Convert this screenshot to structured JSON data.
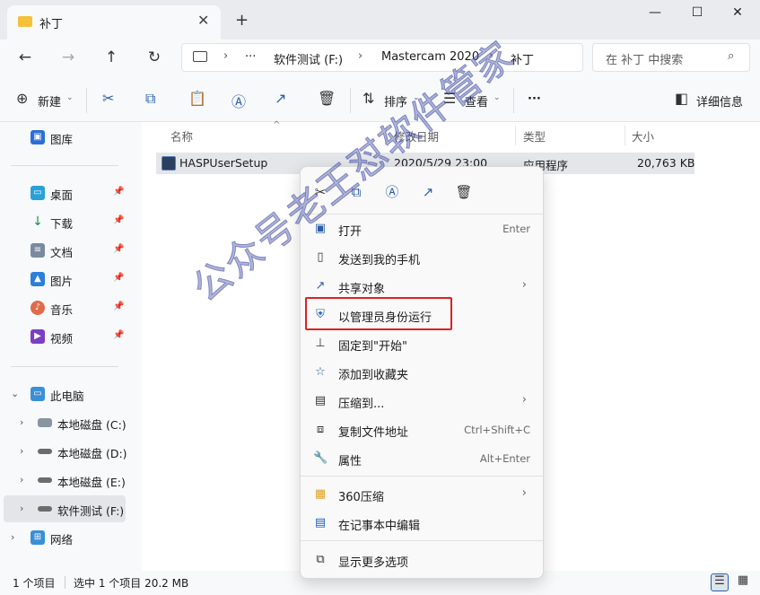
{
  "window": {
    "tab_title": "补丁",
    "tab_close": "✕",
    "new_tab": "+",
    "minimize": "—",
    "maximize": "☐",
    "close": "✕"
  },
  "nav": {
    "back": "←",
    "forward": "→",
    "up": "↑",
    "refresh": "↻",
    "more_crumbs": "···",
    "breadcrumbs": [
      "软件测试 (F:)",
      "Mastercam 2020",
      "补丁"
    ],
    "separator": "›",
    "search_placeholder": "在 补丁 中搜索",
    "search_icon": "⌕"
  },
  "commands": {
    "new_label": "新建",
    "sort_label": "排序",
    "view_label": "查看",
    "more": "···",
    "details_label": "详细信息",
    "caret": "⌄"
  },
  "sidebar": {
    "items": [
      {
        "label": "图库",
        "icon": "gallery-icon"
      },
      {
        "label": "桌面",
        "icon": "desktop-icon",
        "pinned": true
      },
      {
        "label": "下载",
        "icon": "download-icon",
        "pinned": true
      },
      {
        "label": "文档",
        "icon": "documents-icon",
        "pinned": true
      },
      {
        "label": "图片",
        "icon": "pictures-icon",
        "pinned": true
      },
      {
        "label": "音乐",
        "icon": "music-icon",
        "pinned": true
      },
      {
        "label": "视频",
        "icon": "videos-icon",
        "pinned": true
      },
      {
        "label": "此电脑",
        "icon": "this-pc-icon"
      },
      {
        "label": "本地磁盘 (C:)",
        "icon": "drive-icon"
      },
      {
        "label": "本地磁盘 (D:)",
        "icon": "drive-icon"
      },
      {
        "label": "本地磁盘 (E:)",
        "icon": "drive-icon"
      },
      {
        "label": "软件测试 (F:)",
        "icon": "drive-icon",
        "selected": true
      },
      {
        "label": "网络",
        "icon": "network-icon"
      }
    ],
    "pin_glyph": "📌",
    "expand_glyph": "›",
    "expanded_glyph": "⌄"
  },
  "columns": {
    "name": "名称",
    "date": "修改日期",
    "type": "类型",
    "size": "大小",
    "sort_caret": "^"
  },
  "files": [
    {
      "name": "HASPUserSetup",
      "date": "2020/5/29 23:00",
      "type": "应用程序",
      "size": "20,763 KB"
    }
  ],
  "context_menu": {
    "items": [
      {
        "label": "打开",
        "key": "Enter",
        "icon": "open-icon"
      },
      {
        "label": "发送到我的手机",
        "key": "",
        "icon": "phone-icon"
      },
      {
        "label": "共享对象",
        "key": "",
        "icon": "share-icon",
        "submenu": true
      },
      {
        "label": "以管理员身份运行",
        "key": "",
        "icon": "shield-icon"
      },
      {
        "label": "固定到\"开始\"",
        "key": "",
        "icon": "pin-icon"
      },
      {
        "label": "添加到收藏夹",
        "key": "",
        "icon": "star-icon"
      },
      {
        "label": "压缩到...",
        "key": "",
        "icon": "zip-icon",
        "submenu": true
      },
      {
        "label": "复制文件地址",
        "key": "Ctrl+Shift+C",
        "icon": "copy-path-icon"
      },
      {
        "label": "属性",
        "key": "Alt+Enter",
        "icon": "wrench-icon"
      },
      {
        "label": "360压缩",
        "key": "",
        "icon": "archive-360-icon",
        "submenu": true
      },
      {
        "label": "在记事本中编辑",
        "key": "",
        "icon": "notepad-icon"
      },
      {
        "label": "显示更多选项",
        "key": "",
        "icon": "more-options-icon"
      }
    ],
    "submenu_arrow": "›"
  },
  "status": {
    "count": "1 个项目",
    "selected": "选中 1 个项目  20.2 MB"
  },
  "watermark": "公众号老王怼软件管家",
  "colors": {
    "accent": "#2b5ea8",
    "highlight": "#e02020",
    "folder": "#f5c13b"
  }
}
